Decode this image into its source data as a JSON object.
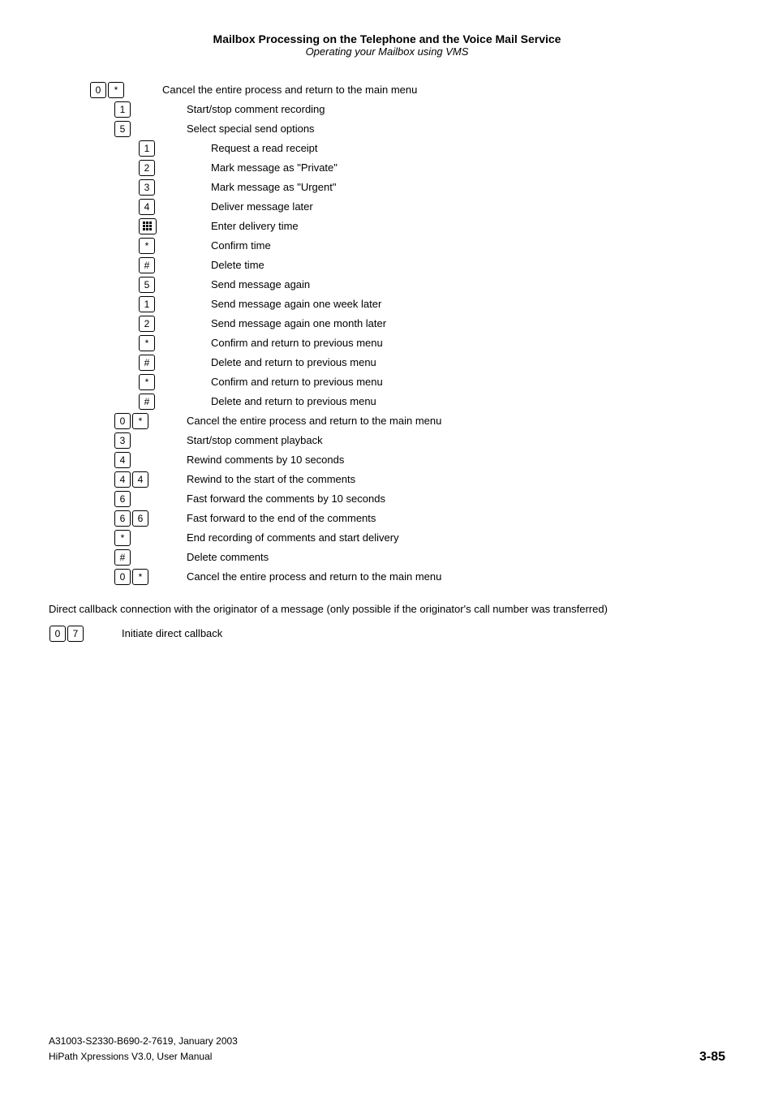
{
  "header": {
    "title": "Mailbox Processing on the Telephone and the Voice Mail Service",
    "subtitle": "Operating your Mailbox using VMS"
  },
  "rows": [
    {
      "keys": [
        {
          "type": "box",
          "label": "0"
        },
        {
          "type": "box",
          "label": "*"
        }
      ],
      "indent": 0,
      "desc": "Cancel the entire process and return to the main menu"
    },
    {
      "keys": [
        {
          "type": "box",
          "label": "1"
        }
      ],
      "indent": 1,
      "desc": "Start/stop comment recording"
    },
    {
      "keys": [
        {
          "type": "box",
          "label": "5"
        }
      ],
      "indent": 1,
      "desc": "Select special send options"
    },
    {
      "keys": [
        {
          "type": "box",
          "label": "1"
        }
      ],
      "indent": 2,
      "desc": "Request a read receipt"
    },
    {
      "keys": [
        {
          "type": "box",
          "label": "2"
        }
      ],
      "indent": 2,
      "desc": "Mark message as \"Private\""
    },
    {
      "keys": [
        {
          "type": "box",
          "label": "3"
        }
      ],
      "indent": 2,
      "desc": "Mark message as \"Urgent\""
    },
    {
      "keys": [
        {
          "type": "box",
          "label": "4"
        }
      ],
      "indent": 2,
      "desc": "Deliver message later"
    },
    {
      "keys": [
        {
          "type": "grid",
          "label": "⊞"
        }
      ],
      "indent": 2,
      "desc": "Enter delivery time"
    },
    {
      "keys": [
        {
          "type": "box",
          "label": "*"
        }
      ],
      "indent": 2,
      "desc": "Confirm time"
    },
    {
      "keys": [
        {
          "type": "box",
          "label": "#"
        }
      ],
      "indent": 2,
      "desc": "Delete time"
    },
    {
      "keys": [
        {
          "type": "box",
          "label": "5"
        }
      ],
      "indent": 2,
      "desc": "Send message again"
    },
    {
      "keys": [
        {
          "type": "box",
          "label": "1"
        }
      ],
      "indent": 2,
      "desc": "Send message again one week later"
    },
    {
      "keys": [
        {
          "type": "box",
          "label": "2"
        }
      ],
      "indent": 2,
      "desc": "Send message again one month later"
    },
    {
      "keys": [
        {
          "type": "box",
          "label": "*"
        }
      ],
      "indent": 2,
      "desc": "Confirm and return to previous menu"
    },
    {
      "keys": [
        {
          "type": "box",
          "label": "#"
        }
      ],
      "indent": 2,
      "desc": "Delete and return to previous menu"
    },
    {
      "keys": [
        {
          "type": "box",
          "label": "□"
        }
      ],
      "indent": 2,
      "desc": "Confirm and return to previous menu"
    },
    {
      "keys": [
        {
          "type": "box",
          "label": "#"
        }
      ],
      "indent": 2,
      "desc": "Delete and return to previous menu"
    },
    {
      "keys": [
        {
          "type": "box",
          "label": "0"
        },
        {
          "type": "box",
          "label": "□"
        }
      ],
      "indent": 1,
      "desc": "Cancel the entire process and return to the main menu"
    },
    {
      "keys": [
        {
          "type": "box",
          "label": "3"
        }
      ],
      "indent": 1,
      "desc": "Start/stop comment playback"
    },
    {
      "keys": [
        {
          "type": "box",
          "label": "4"
        }
      ],
      "indent": 1,
      "desc": "Rewind comments by 10 seconds"
    },
    {
      "keys": [
        {
          "type": "box",
          "label": "4"
        },
        {
          "type": "box",
          "label": "4"
        }
      ],
      "indent": 1,
      "desc": "Rewind to the start of the comments"
    },
    {
      "keys": [
        {
          "type": "box",
          "label": "6"
        }
      ],
      "indent": 1,
      "desc": "Fast forward the comments by 10 seconds"
    },
    {
      "keys": [
        {
          "type": "box",
          "label": "6"
        },
        {
          "type": "box",
          "label": "6"
        }
      ],
      "indent": 1,
      "desc": "Fast forward to the end of the comments"
    },
    {
      "keys": [
        {
          "type": "box",
          "label": "*"
        }
      ],
      "indent": 1,
      "desc": "End recording of comments and start delivery"
    },
    {
      "keys": [
        {
          "type": "box",
          "label": "#"
        }
      ],
      "indent": 1,
      "desc": "Delete comments"
    },
    {
      "keys": [
        {
          "type": "box",
          "label": "0"
        },
        {
          "type": "box",
          "label": "□"
        }
      ],
      "indent": 1,
      "desc": "Cancel the entire process and return to the main menu"
    }
  ],
  "callback_text": "Direct callback connection with the originator of a message (only possible if the originator's call number was transferred)",
  "callback_row": {
    "keys": [
      {
        "type": "box",
        "label": "0"
      },
      {
        "type": "box",
        "label": "7"
      }
    ],
    "desc": "Initiate direct callback"
  },
  "footer": {
    "left_line1": "A31003-S2330-B690-2-7619, January 2003",
    "left_line2": "HiPath Xpressions V3.0, User Manual",
    "right": "3-85"
  }
}
